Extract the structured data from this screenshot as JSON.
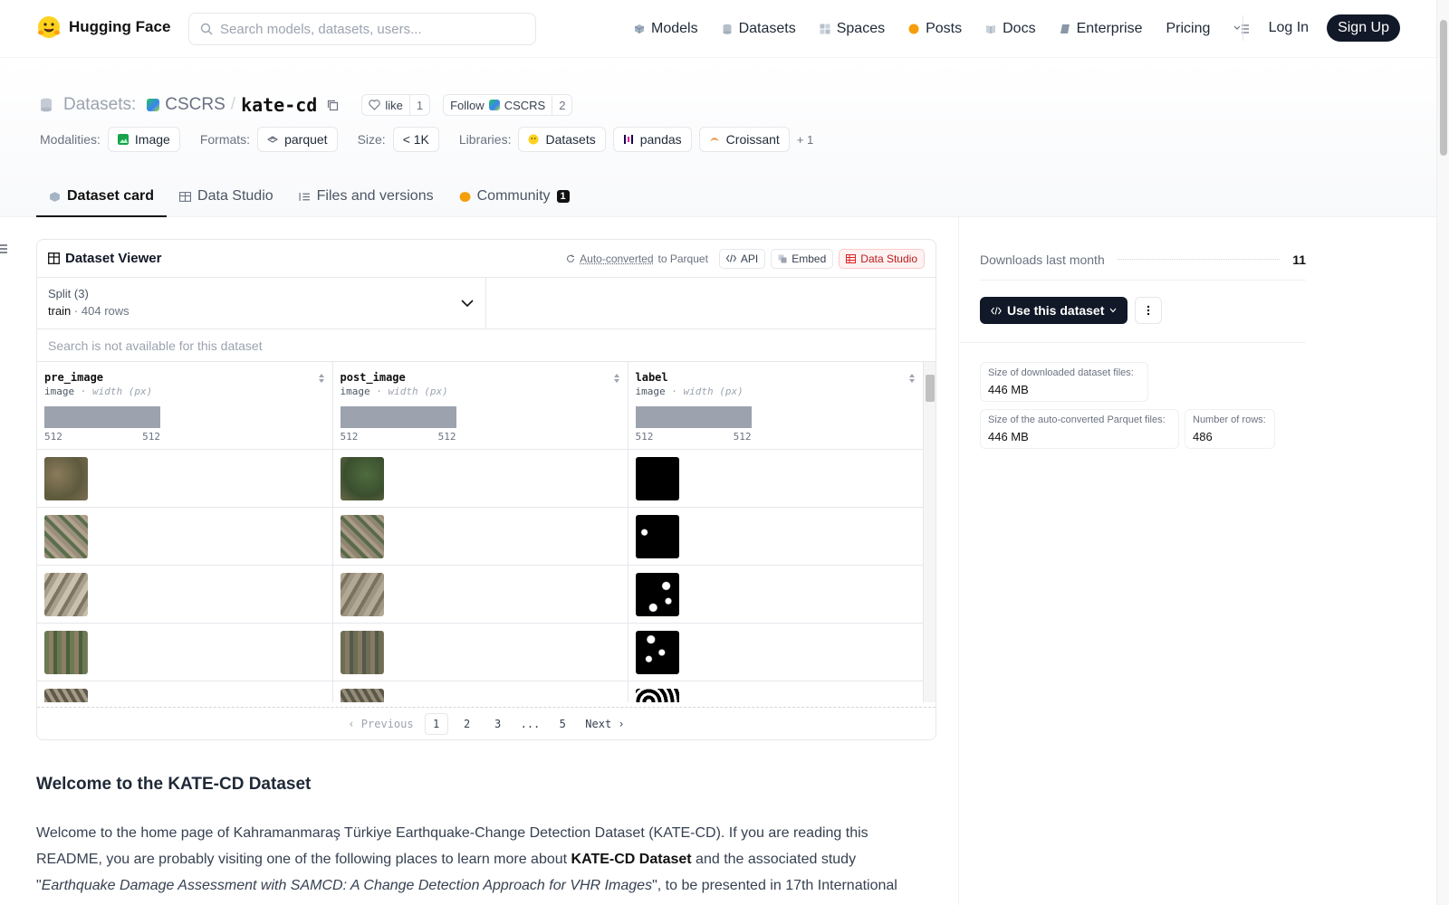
{
  "nav": {
    "brand": "Hugging Face",
    "search_placeholder": "Search models, datasets, users...",
    "links": [
      "Models",
      "Datasets",
      "Spaces",
      "Posts",
      "Docs",
      "Enterprise",
      "Pricing"
    ],
    "login": "Log In",
    "signup": "Sign Up"
  },
  "header": {
    "section": "Datasets:",
    "org": "CSCRS",
    "slash": "/",
    "name": "kate-cd",
    "like_label": "like",
    "like_count": "1",
    "follow_label": "Follow",
    "follow_org": "CSCRS",
    "follow_count": "2"
  },
  "meta": {
    "modalities_label": "Modalities:",
    "modality": "Image",
    "formats_label": "Formats:",
    "format": "parquet",
    "size_label": "Size:",
    "size": "< 1K",
    "libraries_label": "Libraries:",
    "libraries": [
      "Datasets",
      "pandas",
      "Croissant"
    ],
    "more": "+ 1"
  },
  "tabs": {
    "dataset_card": "Dataset card",
    "data_studio": "Data Studio",
    "files": "Files and versions",
    "community": "Community",
    "community_badge": "1"
  },
  "viewer": {
    "title": "Dataset Viewer",
    "auto_converted": "Auto-converted",
    "to_parquet": "to Parquet",
    "api": "API",
    "embed": "Embed",
    "data_studio": "Data Studio",
    "split_label": "Split (3)",
    "split_value": "train",
    "split_sep": "·",
    "split_rows": "404 rows",
    "search_note": "Search is not available for this dataset",
    "columns": [
      {
        "name": "pre_image",
        "type": "image",
        "sub": "· width (px)",
        "min": "512",
        "max": "512"
      },
      {
        "name": "post_image",
        "type": "image",
        "sub": "· width (px)",
        "min": "512",
        "max": "512"
      },
      {
        "name": "label",
        "type": "image",
        "sub": "· width (px)",
        "min": "512",
        "max": "512"
      }
    ],
    "pager": {
      "prev": "Previous",
      "pages": [
        "1",
        "2",
        "3",
        "...",
        "5"
      ],
      "next": "Next",
      "current": "1"
    }
  },
  "readme": {
    "heading": "Welcome to the KATE-CD Dataset",
    "p1": "Welcome to the home page of Kahramanmaraş Türkiye Earthquake-Change Detection Dataset (KATE-CD). If you are reading this README, you are probably visiting one of the following places to learn more about ",
    "p1_bold": "KATE-CD Dataset",
    "p1_rest": " and the associated study \"",
    "p1_italic": "Earthquake Damage Assessment with SAMCD: A Change Detection Approach for VHR Images",
    "p1_end": "\", to be presented in 17th International"
  },
  "sidebar": {
    "downloads_label": "Downloads last month",
    "downloads_value": "11",
    "use_button": "Use this dataset",
    "stats": [
      {
        "label": "Size of downloaded dataset files:",
        "value": "446 MB"
      },
      {
        "label": "Size of the auto-converted Parquet files:",
        "value": "446 MB"
      },
      {
        "label": "Number of rows:",
        "value": "486"
      }
    ]
  },
  "colors": {
    "accent": "#111827",
    "brand_yellow": "#FFD21E",
    "red_badge": "#b91c1c"
  }
}
